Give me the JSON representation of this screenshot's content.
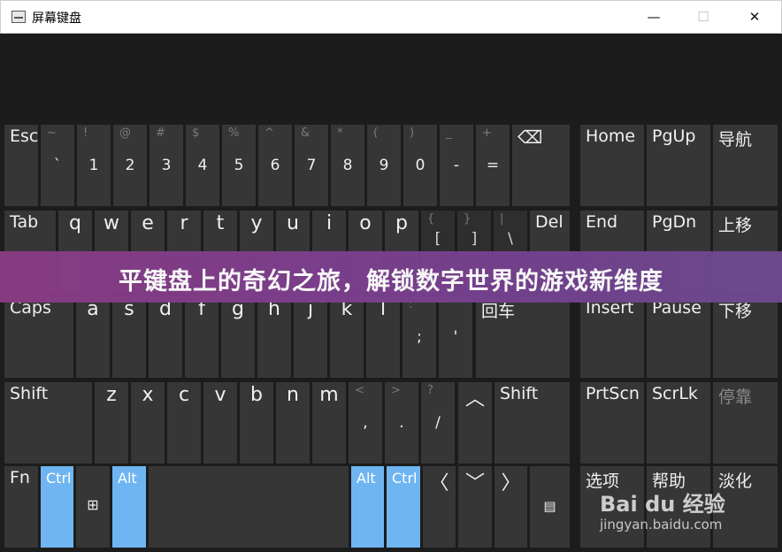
{
  "window": {
    "title": "屏幕键盘",
    "minimize": "—",
    "maximize": "☐",
    "close": "✕"
  },
  "banner": {
    "text": "平键盘上的奇幻之旅，解锁数字世界的游戏新维度"
  },
  "watermark": {
    "logo": "Bai du 经验",
    "url": "jingyan.baidu.com"
  },
  "keys": {
    "esc": "Esc",
    "row1": [
      {
        "top": "~",
        "main": "`"
      },
      {
        "top": "!",
        "main": "1"
      },
      {
        "top": "@",
        "main": "2"
      },
      {
        "top": "#",
        "main": "3"
      },
      {
        "top": "$",
        "main": "4"
      },
      {
        "top": "%",
        "main": "5"
      },
      {
        "top": "^",
        "main": "6"
      },
      {
        "top": "&",
        "main": "7"
      },
      {
        "top": "*",
        "main": "8"
      },
      {
        "top": "(",
        "main": "9"
      },
      {
        "top": ")",
        "main": "0"
      },
      {
        "top": "_",
        "main": "-"
      },
      {
        "top": "+",
        "main": "="
      }
    ],
    "backspace_icon": "⌫",
    "tab": "Tab",
    "row2": [
      "q",
      "w",
      "e",
      "r",
      "t",
      "y",
      "u",
      "i",
      "o",
      "p"
    ],
    "row2_sym": [
      {
        "top": "{",
        "main": "["
      },
      {
        "top": "}",
        "main": "]"
      },
      {
        "top": "|",
        "main": "\\"
      }
    ],
    "del": "Del",
    "caps": "Caps",
    "row3": [
      "a",
      "s",
      "d",
      "f",
      "g",
      "h",
      "j",
      "k",
      "l"
    ],
    "row3_sym": [
      {
        "top": ":",
        "main": ";"
      },
      {
        "top": "\"",
        "main": "'"
      }
    ],
    "enter": "回车",
    "shift_left": "Shift",
    "row4": [
      "z",
      "x",
      "c",
      "v",
      "b",
      "n",
      "m"
    ],
    "row4_sym": [
      {
        "top": "<",
        "main": ","
      },
      {
        "top": ">",
        "main": "."
      },
      {
        "top": "?",
        "main": "/"
      }
    ],
    "up": "︿",
    "shift_right": "Shift",
    "fn": "Fn",
    "ctrl_left": "Ctrl",
    "win": "⊞",
    "alt_left": "Alt",
    "alt_right": "Alt",
    "ctrl_right": "Ctrl",
    "left": "〈",
    "down": "﹀",
    "right": "〉",
    "menu": "▤",
    "nav": [
      [
        "Home",
        "PgUp",
        "导航"
      ],
      [
        "End",
        "PgDn",
        "上移"
      ],
      [
        "Insert",
        "Pause",
        "下移"
      ],
      [
        "PrtScn",
        "ScrLk",
        "停靠"
      ],
      [
        "选项",
        "帮助",
        "淡化"
      ]
    ]
  },
  "colors": {
    "background": "#1c1c1c",
    "key": "#363636",
    "active_modifier": "#6fb5f2",
    "banner": "#7d3f8e"
  }
}
